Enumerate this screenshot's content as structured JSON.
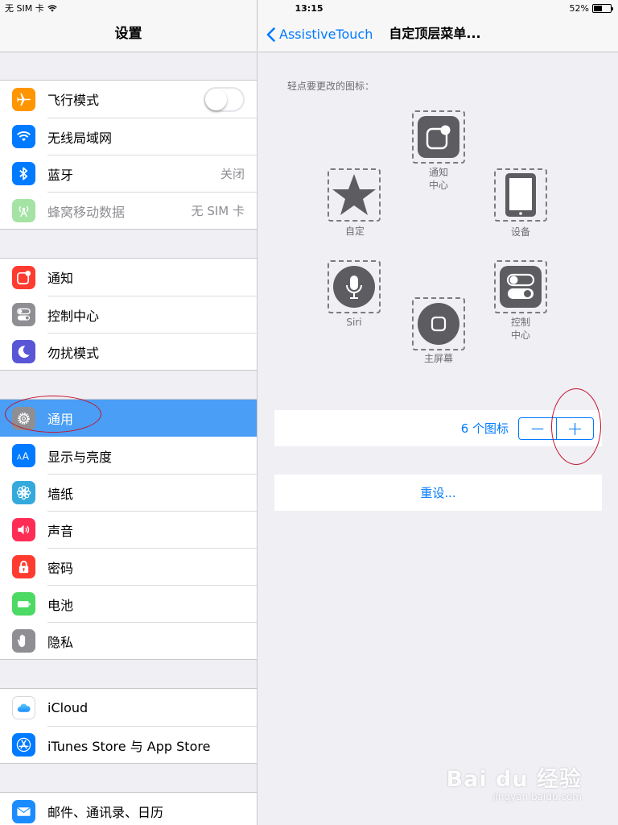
{
  "status_bar": {
    "carrier": "无 SIM 卡",
    "time": "13:15",
    "battery": "52%",
    "battery_level": 0.52
  },
  "left": {
    "title": "设置",
    "groups": [
      [
        {
          "label": "飞行模式",
          "icon": "airplane-icon",
          "color": "#ff9500",
          "control": "toggle"
        },
        {
          "label": "无线局域网",
          "icon": "wifi-icon",
          "color": "#007aff"
        },
        {
          "label": "蓝牙",
          "icon": "bluetooth-icon",
          "color": "#007aff",
          "value": "关闭"
        },
        {
          "label": "蜂窝移动数据",
          "icon": "cellular-icon",
          "color": "#a5e3a4",
          "value": "无 SIM 卡"
        }
      ],
      [
        {
          "label": "通知",
          "icon": "notifications-icon",
          "color": "#ff3b30"
        },
        {
          "label": "控制中心",
          "icon": "control-center-icon",
          "color": "#8e8e93"
        },
        {
          "label": "勿扰模式",
          "icon": "moon-icon",
          "color": "#5856d6"
        }
      ],
      [
        {
          "label": "通用",
          "icon": "gear-icon",
          "color": "#8e8e93",
          "selected": true
        },
        {
          "label": "显示与亮度",
          "icon": "text-size-icon",
          "color": "#007aff"
        },
        {
          "label": "墙纸",
          "icon": "flower-icon",
          "color": "#34aadc"
        },
        {
          "label": "声音",
          "icon": "speaker-icon",
          "color": "#ff2d55"
        },
        {
          "label": "密码",
          "icon": "lock-icon",
          "color": "#ff3b30"
        },
        {
          "label": "电池",
          "icon": "battery-icon",
          "color": "#4cd964"
        },
        {
          "label": "隐私",
          "icon": "hand-icon",
          "color": "#8e8e93"
        }
      ],
      [
        {
          "label": "iCloud",
          "icon": "cloud-icon",
          "color": "#ffffff"
        },
        {
          "label": "iTunes Store 与 App Store",
          "icon": "app-store-icon",
          "color": "#007aff"
        }
      ],
      [
        {
          "label": "邮件、通讯录、日历",
          "icon": "mail-icon",
          "color": "#1a8cff"
        }
      ]
    ]
  },
  "right": {
    "back_label": "AssistiveTouch",
    "title": "自定顶层菜单...",
    "hint": "轻点要更改的图标：",
    "menu_items": {
      "notification": {
        "label": "通知\n中心"
      },
      "device": {
        "label": "设备"
      },
      "custom": {
        "label": "自定"
      },
      "siri": {
        "label": "Siri"
      },
      "control": {
        "label": "控制\n中心"
      },
      "home": {
        "label": "主屏幕"
      }
    },
    "count_label": "6 个图标",
    "minus": "—",
    "plus": "+",
    "reset_label": "重设..."
  },
  "watermark": {
    "main": "Bai du 经验",
    "sub": "jingyan.baidu.com"
  }
}
